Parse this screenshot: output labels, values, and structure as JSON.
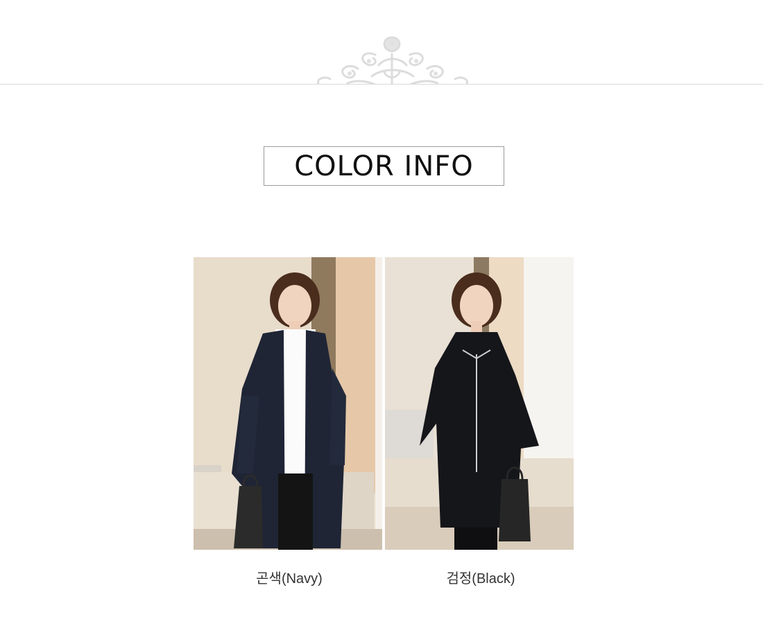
{
  "section": {
    "title": "COLOR INFO"
  },
  "colors": [
    {
      "label": "곤색(Navy)",
      "swatch": "#1f2535"
    },
    {
      "label": "검정(Black)",
      "swatch": "#15161a"
    }
  ],
  "theme": {
    "divider": "#d9d9d9",
    "ornament": "#e3e3e3"
  }
}
